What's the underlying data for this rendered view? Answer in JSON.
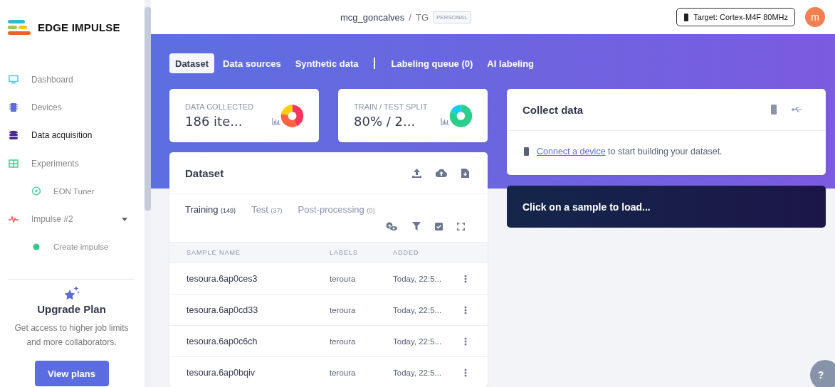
{
  "brand": "EDGE IMPULSE",
  "sidebar": {
    "items": [
      {
        "label": "Dashboard",
        "selected": false
      },
      {
        "label": "Devices",
        "selected": false
      },
      {
        "label": "Data acquisition",
        "selected": true
      },
      {
        "label": "Experiments",
        "selected": false,
        "children": [
          {
            "label": "EON Tuner",
            "selected": false
          }
        ]
      },
      {
        "label": "Impulse #2",
        "selected": false,
        "expanded": true,
        "children": [
          {
            "label": "Create impulse",
            "selected": false
          }
        ]
      }
    ],
    "upgrade": {
      "title": "Upgrade Plan",
      "text": "Get access to higher job limits and more collaborators.",
      "button": "View plans"
    }
  },
  "header": {
    "user": "mcg_goncalves",
    "separator": "/",
    "project": "TG",
    "badge": "PERSONAL",
    "target": "Target: Cortex-M4F 80MHz",
    "avatar": "m"
  },
  "tabs": [
    {
      "label": "Dataset",
      "selected": true
    },
    {
      "label": "Data sources",
      "selected": false
    },
    {
      "label": "Synthetic data",
      "selected": false
    },
    {
      "label": "Labeling queue (0)",
      "selected": false
    },
    {
      "label": "AI labeling",
      "selected": false
    }
  ],
  "stats": [
    {
      "title": "DATA COLLECTED",
      "value": "186 ite..."
    },
    {
      "title": "TRAIN / TEST SPLIT",
      "value": "80% / 2..."
    }
  ],
  "dataset": {
    "title": "Dataset",
    "subtabs": [
      {
        "label": "Training",
        "count": "(149)",
        "selected": true
      },
      {
        "label": "Test",
        "count": "(37)",
        "selected": false
      },
      {
        "label": "Post-processing",
        "count": "(0)",
        "selected": false
      }
    ],
    "columns": [
      "SAMPLE NAME",
      "LABELS",
      "ADDED"
    ],
    "rows": [
      {
        "name": "tesoura.6ap0ces3",
        "label": "teroura",
        "added": "Today, 22:5..."
      },
      {
        "name": "tesoura.6ap0cd33",
        "label": "teroura",
        "added": "Today, 22:5..."
      },
      {
        "name": "tesoura.6ap0c6ch",
        "label": "teroura",
        "added": "Today, 22:5..."
      },
      {
        "name": "tesoura.6ap0bqiv",
        "label": "teroura",
        "added": "Today, 22:5..."
      }
    ]
  },
  "collect": {
    "title": "Collect data",
    "link": "Connect a device",
    "text": " to start building your dataset."
  },
  "sample_panel": {
    "text": "Click on a sample to load..."
  },
  "help": {
    "label": "?"
  }
}
